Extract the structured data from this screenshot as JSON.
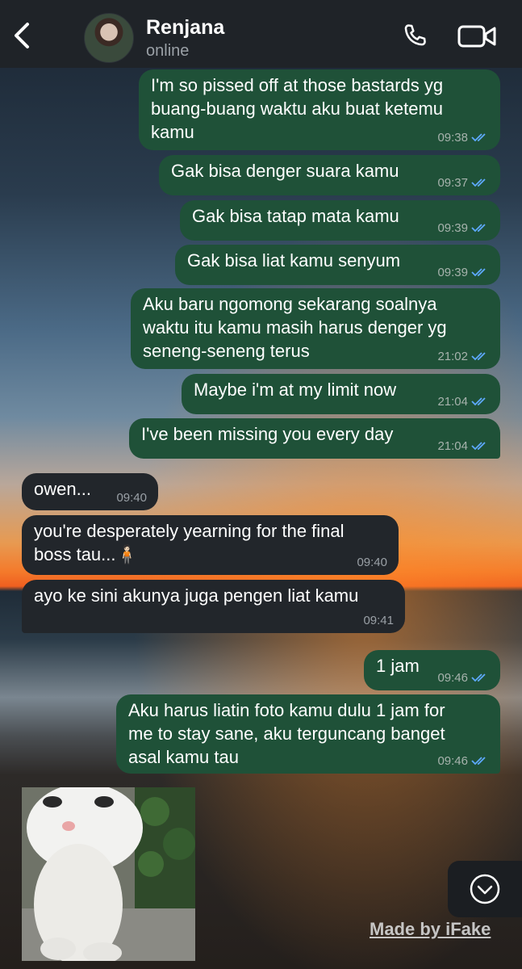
{
  "contact": {
    "name": "Renjana",
    "status": "online"
  },
  "messages": [
    {
      "dir": "out",
      "lines": [
        "I'm so pissed off at those bastards yg",
        "buang-buang waktu aku buat ketemu",
        "kamu"
      ],
      "time": "09:38"
    },
    {
      "dir": "out",
      "lines": [
        "Gak bisa denger suara kamu"
      ],
      "time": "09:37"
    },
    {
      "dir": "out",
      "lines": [
        "Gak bisa tatap mata kamu"
      ],
      "time": "09:39"
    },
    {
      "dir": "out",
      "lines": [
        "Gak bisa liat kamu senyum"
      ],
      "time": "09:39"
    },
    {
      "dir": "out",
      "lines": [
        "Aku baru ngomong sekarang soalnya",
        "waktu itu kamu masih harus denger yg",
        "seneng-seneng terus"
      ],
      "time": "21:02"
    },
    {
      "dir": "out",
      "lines": [
        "Maybe i'm at my limit now"
      ],
      "time": "21:04"
    },
    {
      "dir": "out",
      "lines": [
        "I've been missing you every day"
      ],
      "time": "21:04"
    },
    {
      "dir": "in",
      "lines": [
        "owen..."
      ],
      "time": "09:40"
    },
    {
      "dir": "in",
      "lines": [
        "you're desperately yearning for the final",
        "boss tau...🧍🏻"
      ],
      "time": "09:40"
    },
    {
      "dir": "in",
      "lines": [
        "ayo ke sini akunya juga pengen liat kamu"
      ],
      "time": "09:41"
    },
    {
      "dir": "out",
      "lines": [
        "1 jam"
      ],
      "time": "09:46"
    },
    {
      "dir": "out",
      "lines": [
        "Aku harus liatin foto kamu dulu 1 jam for",
        "me to stay sane, aku terguncang banget",
        "asal kamu tau"
      ],
      "time": "09:46"
    }
  ],
  "watermark": "Made by iFake",
  "icons": {
    "back": "chevron-left-icon",
    "call": "phone-icon",
    "video": "video-camera-icon",
    "scroll": "chevron-down-circle-icon"
  },
  "colors": {
    "outgoing": "#1f5138",
    "incoming": "#22262b",
    "header": "#1f2328",
    "ticks": "#5ea9ff"
  }
}
